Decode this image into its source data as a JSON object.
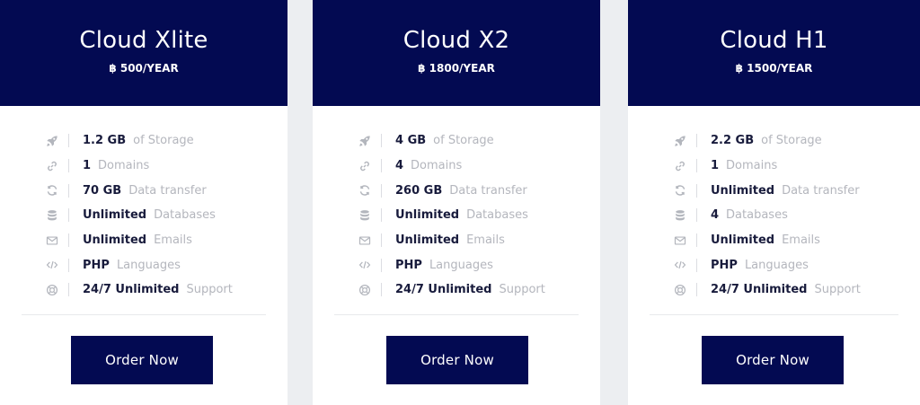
{
  "plans": [
    {
      "name": "Cloud Xlite",
      "price": "฿ 500/YEAR",
      "features": [
        {
          "icon": "rocket-icon",
          "value": "1.2 GB",
          "label": "of Storage"
        },
        {
          "icon": "link-icon",
          "value": "1",
          "label": "Domains"
        },
        {
          "icon": "refresh-icon",
          "value": "70 GB",
          "label": "Data transfer"
        },
        {
          "icon": "database-icon",
          "value": "Unlimited",
          "label": "Databases"
        },
        {
          "icon": "envelope-icon",
          "value": "Unlimited",
          "label": "Emails"
        },
        {
          "icon": "code-icon",
          "value": "PHP",
          "label": "Languages"
        },
        {
          "icon": "lifebuoy-icon",
          "value": "24/7 Unlimited",
          "label": "Support"
        }
      ],
      "button_label": "Order Now"
    },
    {
      "name": "Cloud X2",
      "price": "฿ 1800/YEAR",
      "features": [
        {
          "icon": "rocket-icon",
          "value": "4 GB",
          "label": "of Storage"
        },
        {
          "icon": "link-icon",
          "value": "4",
          "label": "Domains"
        },
        {
          "icon": "refresh-icon",
          "value": "260 GB",
          "label": "Data transfer"
        },
        {
          "icon": "database-icon",
          "value": "Unlimited",
          "label": "Databases"
        },
        {
          "icon": "envelope-icon",
          "value": "Unlimited",
          "label": "Emails"
        },
        {
          "icon": "code-icon",
          "value": "PHP",
          "label": "Languages"
        },
        {
          "icon": "lifebuoy-icon",
          "value": "24/7 Unlimited",
          "label": "Support"
        }
      ],
      "button_label": "Order Now"
    },
    {
      "name": "Cloud H1",
      "price": "฿ 1500/YEAR",
      "features": [
        {
          "icon": "rocket-icon",
          "value": "2.2 GB",
          "label": "of Storage"
        },
        {
          "icon": "link-icon",
          "value": "1",
          "label": "Domains"
        },
        {
          "icon": "refresh-icon",
          "value": "Unlimited",
          "label": "Data transfer"
        },
        {
          "icon": "database-icon",
          "value": "4",
          "label": "Databases"
        },
        {
          "icon": "envelope-icon",
          "value": "Unlimited",
          "label": "Emails"
        },
        {
          "icon": "code-icon",
          "value": "PHP",
          "label": "Languages"
        },
        {
          "icon": "lifebuoy-icon",
          "value": "24/7 Unlimited",
          "label": "Support"
        }
      ],
      "button_label": "Order Now"
    }
  ],
  "colors": {
    "header_bg": "#030a52",
    "button_bg": "#030a52",
    "value_text": "#181b3c",
    "label_text": "#b4b6bd",
    "icon": "#b3b6bd",
    "page_bg": "#eceef1"
  }
}
